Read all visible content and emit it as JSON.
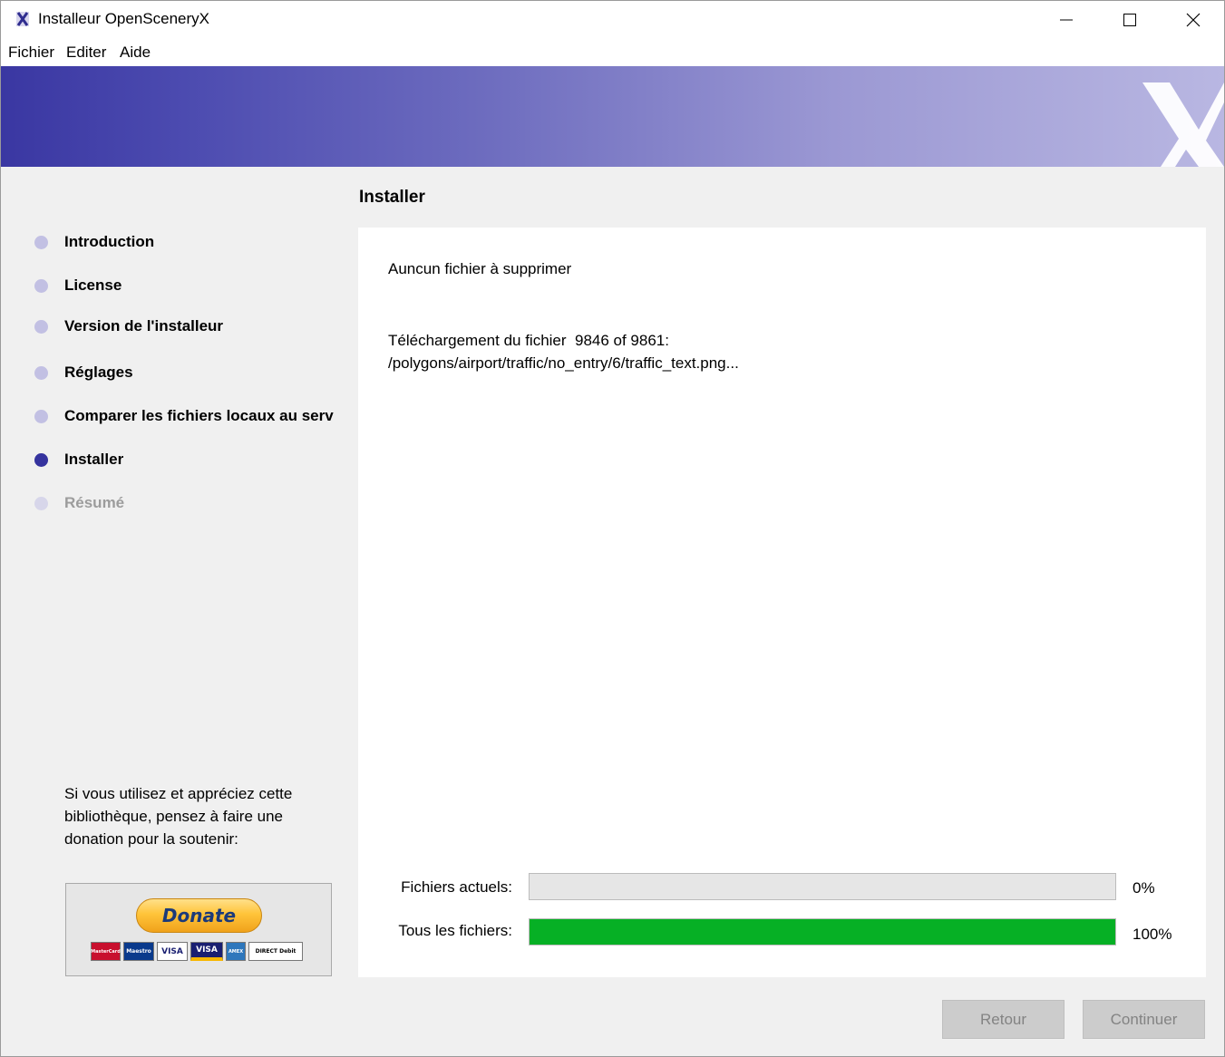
{
  "window": {
    "title": "Installeur OpenSceneryX",
    "app_icon": "opensceneryx-icon",
    "controls": [
      "minimize-icon",
      "maximize-icon",
      "close-icon"
    ]
  },
  "menu": {
    "items": [
      "Fichier",
      "Editer",
      "Aide"
    ]
  },
  "banner": {
    "logo_icon": "opensceneryx-x-logo",
    "gradient_start": "#3a37a2",
    "gradient_end": "#b9b7e2"
  },
  "steps": [
    {
      "label": "Introduction",
      "state": "done"
    },
    {
      "label": "License",
      "state": "done"
    },
    {
      "label": "Version de l'installeur",
      "state": "done"
    },
    {
      "label": "Réglages",
      "state": "done"
    },
    {
      "label": "Comparer les fichiers locaux au serv",
      "state": "done"
    },
    {
      "label": "Installer",
      "state": "active"
    },
    {
      "label": "Résumé",
      "state": "pending"
    }
  ],
  "donate": {
    "text": "Si vous utilisez et appréciez cette bibliothèque, pensez à faire une donation pour la soutenir:",
    "button_label": "Donate",
    "cards": [
      "MasterCard",
      "Maestro",
      "VISA",
      "VISA",
      "AMEX",
      "DIRECT Debit"
    ]
  },
  "main": {
    "title": "Installer",
    "message_delete": "Auncun fichier à supprimer",
    "message_download_line1": "Téléchargement du fichier  9846 of 9861:",
    "message_download_line2": "/polygons/airport/traffic/no_entry/6/traffic_text.png..."
  },
  "progress": {
    "current_label": "Fichiers actuels:",
    "current_value": "0%",
    "current_fraction": 0,
    "total_label": "Tous les fichiers:",
    "total_value": "100%",
    "total_fraction": 1,
    "fill_color": "#06b025"
  },
  "buttons": {
    "back": "Retour",
    "next": "Continuer"
  }
}
